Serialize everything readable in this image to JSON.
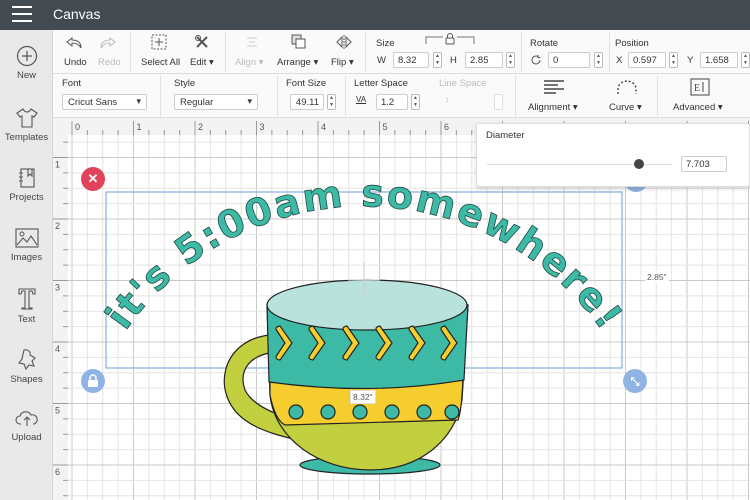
{
  "header": {
    "title": "Canvas",
    "menu_icon": "hamburger-icon"
  },
  "sidebar": {
    "items": [
      {
        "label": "New",
        "icon": "plus-circle-icon"
      },
      {
        "label": "Templates",
        "icon": "tshirt-icon"
      },
      {
        "label": "Projects",
        "icon": "notebook-icon"
      },
      {
        "label": "Images",
        "icon": "image-icon"
      },
      {
        "label": "Text",
        "icon": "text-icon"
      },
      {
        "label": "Shapes",
        "icon": "shapes-icon"
      },
      {
        "label": "Upload",
        "icon": "cloud-upload-icon"
      }
    ]
  },
  "toolbar": {
    "undo": "Undo",
    "redo": "Redo",
    "select_all": "Select All",
    "edit": "Edit",
    "align": "Align",
    "arrange": "Arrange",
    "flip": "Flip",
    "size": {
      "label": "Size",
      "w_label": "W",
      "w": "8.32",
      "h_label": "H",
      "h": "2.85"
    },
    "rotate": {
      "label": "Rotate",
      "value": "0"
    },
    "position": {
      "label": "Position",
      "x_label": "X",
      "x": "0.597",
      "y_label": "Y",
      "y": "1.658"
    }
  },
  "text_toolbar": {
    "font_label": "Font",
    "font": "Cricut Sans",
    "style_label": "Style",
    "style": "Regular",
    "font_size_label": "Font Size",
    "font_size": "49.11",
    "letter_space_label": "Letter Space",
    "letter_space": "1.2",
    "line_space_label": "Line Space",
    "alignment": "Alignment",
    "curve": "Curve",
    "advanced": "Advanced"
  },
  "diameter_panel": {
    "label": "Diameter",
    "value": "7.703",
    "slider_fraction": 0.82
  },
  "ruler": {
    "top": [
      "0",
      "1",
      "2",
      "3",
      "4",
      "5",
      "6"
    ],
    "left": [
      "1",
      "2",
      "3",
      "4",
      "5",
      "6"
    ]
  },
  "canvas": {
    "curved_text": "it's 5:00am somewhere!",
    "height_label": "2.85\"",
    "width_label": "8.32\"",
    "colors": {
      "text": "#3dbaa6",
      "cup_teal": "#3dbaa6",
      "cup_rim": "#b9e2dc",
      "cup_yellow": "#f6cd2f",
      "cup_green": "#c2cf3e",
      "selection": "#9bbde6",
      "delete": "#e0435a"
    }
  }
}
